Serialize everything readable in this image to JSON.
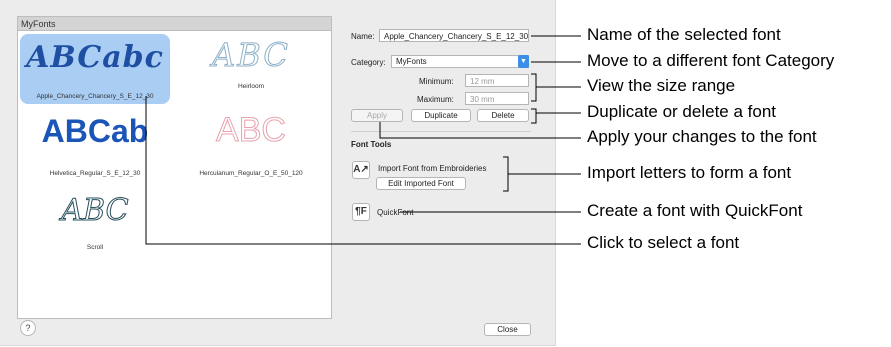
{
  "dialog": {
    "panel_title": "MyFonts",
    "fonts": [
      {
        "preview": "ABCabc",
        "caption": "Apple_Chancery_Chancery_S_E_12_30",
        "selected": true
      },
      {
        "preview": "ABC",
        "caption": "Heirloom",
        "selected": false
      },
      {
        "preview": "ABCab",
        "caption": "Helvetica_Regular_S_E_12_30",
        "selected": false
      },
      {
        "preview": "ABC",
        "caption": "Herculanum_Regular_O_E_50_120",
        "selected": false
      },
      {
        "preview": "ABC",
        "caption": "Scroll",
        "selected": false
      }
    ],
    "name_label": "Name:",
    "name_value": "Apple_Chancery_Chancery_S_E_12_30",
    "category_label": "Category:",
    "category_value": "MyFonts",
    "minimum_label": "Minimum:",
    "minimum_value": "12 mm",
    "maximum_label": "Maximum:",
    "maximum_value": "30 mm",
    "apply_label": "Apply",
    "duplicate_label": "Duplicate",
    "delete_label": "Delete",
    "font_tools_title": "Font Tools",
    "import_label": "Import Font from Embroideries",
    "edit_imported_label": "Edit Imported Font",
    "quickfont_label": "QuickFont",
    "help_label": "?",
    "close_label": "Close"
  },
  "callouts": {
    "name": "Name of the selected font",
    "category": "Move to a different font Category",
    "size": "View the size range",
    "duplicate": "Duplicate or delete a font",
    "apply": "Apply your changes to the font",
    "import": "Import letters to form a font",
    "quickfont": "Create a font with QuickFont",
    "select": "Click to select a font"
  },
  "colors": {
    "accent": "#3d8ee6",
    "selection": "#a9cdf3",
    "script_blue": "#1f4fa3",
    "helvetica_blue": "#1c55b8",
    "herculanum_pink": "#e7a3ad",
    "scroll_teal": "#274f5c"
  }
}
